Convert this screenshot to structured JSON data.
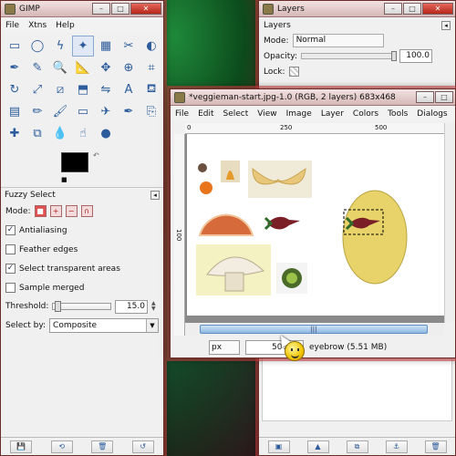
{
  "toolbox": {
    "title": "GIMP",
    "menus": [
      "File",
      "Xtns",
      "Help"
    ],
    "tools": [
      "rect-select",
      "ellipse-select",
      "free-select",
      "fuzzy-select",
      "select-by-color",
      "scissors",
      "foreground-select",
      "paths",
      "color-picker",
      "zoom",
      "measure",
      "move",
      "align",
      "crop",
      "rotate",
      "scale",
      "shear",
      "perspective",
      "flip",
      "text",
      "bucket-fill",
      "blend",
      "pencil",
      "paintbrush",
      "eraser",
      "airbrush",
      "ink",
      "clone",
      "heal",
      "perspective-clone",
      "blur",
      "smudge",
      "dodge-burn"
    ],
    "active_tool_index": 3,
    "fg_color": "#000000",
    "bg_color": "#ffffff",
    "options_title": "Fuzzy Select",
    "mode_label": "Mode:",
    "antialiasing_label": "Antialiasing",
    "feather_label": "Feather edges",
    "select_transparent_label": "Select transparent areas",
    "sample_merged_label": "Sample merged",
    "threshold_label": "Threshold:",
    "threshold_value": "15.0",
    "select_by_label": "Select by:",
    "select_by_value": "Composite",
    "checks": {
      "antialiasing": true,
      "feather": false,
      "transparent": true,
      "sample_merged": false
    }
  },
  "layers": {
    "title": "Layers",
    "header": "Layers",
    "mode_label": "Mode:",
    "mode_value": "Normal",
    "opacity_label": "Opacity:",
    "opacity_value": "100.0",
    "lock_label": "Lock:"
  },
  "image_window": {
    "title": "*veggieman-start.jpg-1.0 (RGB, 2 layers) 683x468",
    "menus": [
      "File",
      "Edit",
      "Select",
      "View",
      "Image",
      "Layer",
      "Colors",
      "Tools",
      "Dialogs"
    ],
    "ruler_h": [
      "0",
      "250",
      "500"
    ],
    "ruler_v": [
      "100"
    ],
    "unit": "px",
    "zoom": "50%",
    "status_text": "eyebrow (5.51 MB)"
  }
}
